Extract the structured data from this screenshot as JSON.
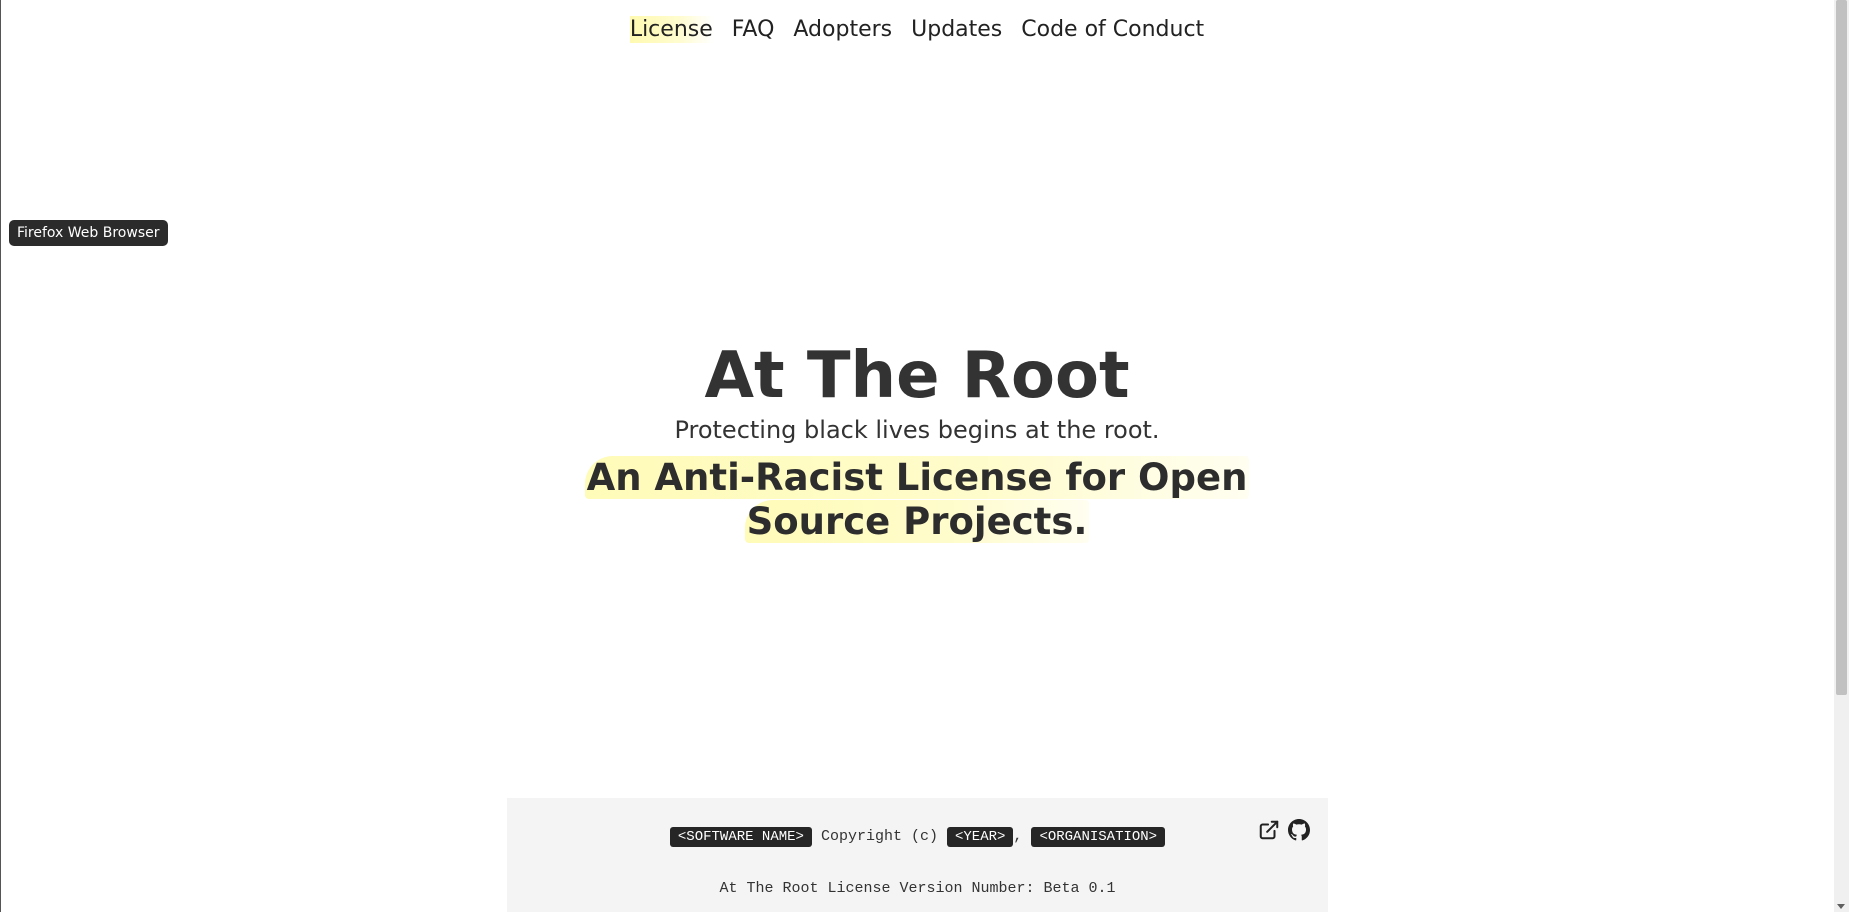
{
  "nav": {
    "items": [
      {
        "label": "License",
        "active": true
      },
      {
        "label": "FAQ"
      },
      {
        "label": "Adopters"
      },
      {
        "label": "Updates"
      },
      {
        "label": "Code of Conduct"
      }
    ]
  },
  "tooltip": {
    "text": "Firefox Web Browser"
  },
  "hero": {
    "title": "At The Root",
    "subtitle": "Protecting black lives begins at the root.",
    "tagline": "An Anti-Racist License for Open Source Projects."
  },
  "license": {
    "software_name": "<SOFTWARE NAME>",
    "copyright_text": "Copyright (c)",
    "year": "<YEAR>",
    "separator": ",",
    "organisation": "<ORGANISATION>",
    "version_line": "At The Root License Version Number: Beta 0.1",
    "icons": [
      "external-link-icon",
      "github-icon"
    ]
  },
  "colors": {
    "highlight": "#fffbb8",
    "tag_bg": "#262626",
    "box_bg": "#f4f4f4",
    "text": "#333333"
  }
}
